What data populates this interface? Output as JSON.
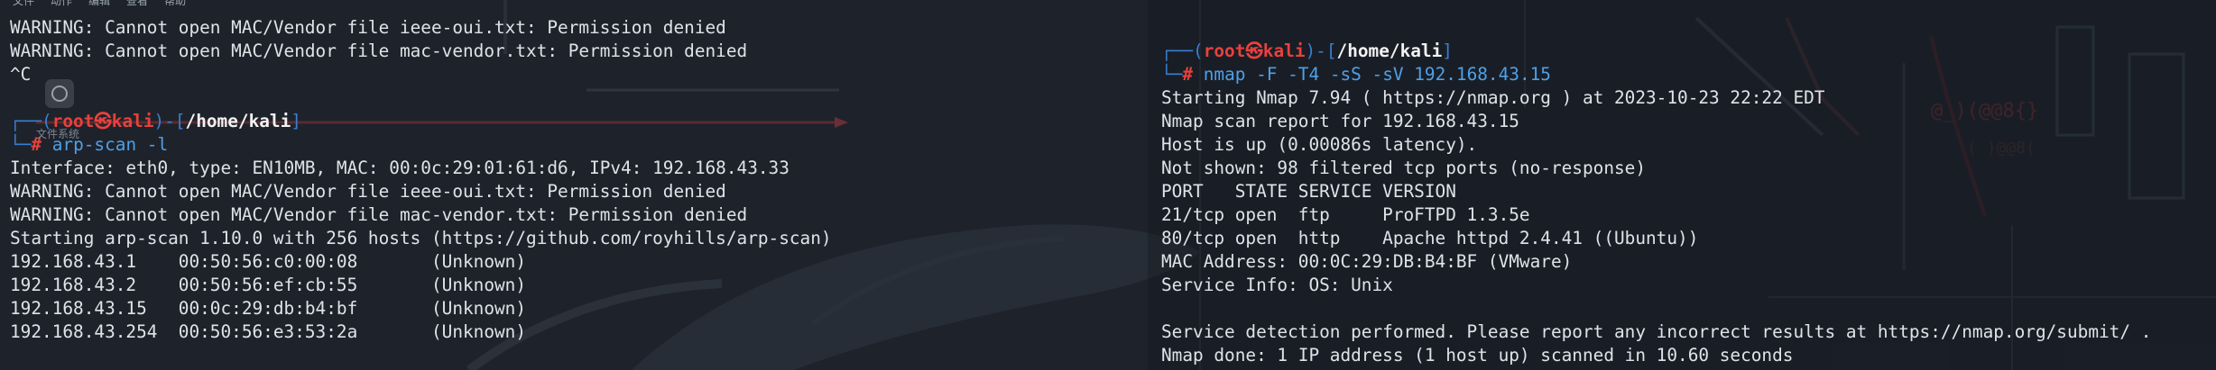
{
  "menubar": [
    "文件",
    "动作",
    "编辑",
    "查看",
    "帮助"
  ],
  "desktop_icon_label": "文件系统",
  "prompt": {
    "user": "root",
    "host": "kali",
    "path": "/home/kali",
    "symbol": "#"
  },
  "left_terminal": {
    "top_lines": [
      "WARNING: Cannot open MAC/Vendor file ieee-oui.txt: Permission denied",
      "WARNING: Cannot open MAC/Vendor file mac-vendor.txt: Permission denied",
      "^C"
    ],
    "command": "arp-scan -l",
    "output": [
      "Interface: eth0, type: EN10MB, MAC: 00:0c:29:01:61:d6, IPv4: 192.168.43.33",
      "WARNING: Cannot open MAC/Vendor file ieee-oui.txt: Permission denied",
      "WARNING: Cannot open MAC/Vendor file mac-vendor.txt: Permission denied",
      "Starting arp-scan 1.10.0 with 256 hosts (https://github.com/royhills/arp-scan)",
      "192.168.43.1    00:50:56:c0:00:08       (Unknown)",
      "192.168.43.2    00:50:56:ef:cb:55       (Unknown)",
      "192.168.43.15   00:0c:29:db:b4:bf       (Unknown)",
      "192.168.43.254  00:50:56:e3:53:2a       (Unknown)"
    ]
  },
  "right_terminal": {
    "command": "nmap -F -T4 -sS -sV 192.168.43.15",
    "output": [
      "Starting Nmap 7.94 ( https://nmap.org ) at 2023-10-23 22:22 EDT",
      "Nmap scan report for 192.168.43.15",
      "Host is up (0.00086s latency).",
      "Not shown: 98 filtered tcp ports (no-response)",
      "PORT   STATE SERVICE VERSION",
      "21/tcp open  ftp     ProFTPD 1.3.5e",
      "80/tcp open  http    Apache httpd 2.4.41 ((Ubuntu))",
      "MAC Address: 00:0C:29:DB:B4:BF (VMware)",
      "Service Info: OS: Unix",
      "",
      "Service detection performed. Please report any incorrect results at https://nmap.org/submit/ .",
      "Nmap done: 1 IP address (1 host up) scanned in 10.60 seconds"
    ]
  }
}
